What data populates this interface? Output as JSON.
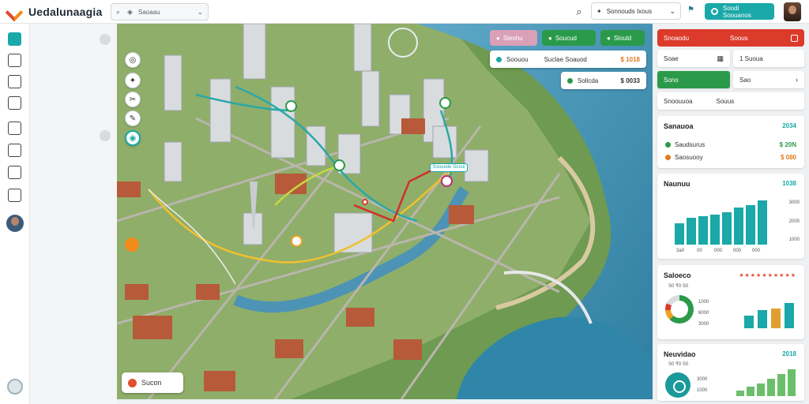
{
  "app": {
    "title": "Uedalunaagia"
  },
  "top_toolbar": {
    "label": "Saoaau",
    "icons": [
      "search-icon",
      "layers-icon"
    ]
  },
  "location_select": {
    "value": "Sonnouds Ixous"
  },
  "primary_action": {
    "label": "Soodi Soouanos"
  },
  "map_overlay": {
    "chips": [
      {
        "label": "Sleohu",
        "color": "#d9a0b8"
      },
      {
        "label": "Soucud",
        "color": "#2a9a4a"
      },
      {
        "label": "Slould",
        "color": "#2a9a4a"
      }
    ],
    "route_card_1": {
      "left": "Soouou",
      "mid": "Suclae Soauod",
      "value": "$ 1018"
    },
    "route_card_2": {
      "left": "Sollcda",
      "value": "$ 0033"
    },
    "route_tag": "Soouede Sooul",
    "legend_button": "Sucon"
  },
  "right_panel": {
    "header": {
      "left": "Snoaodu",
      "right": "Soous"
    },
    "row1": {
      "left": "Soae",
      "right": "1 Suoua"
    },
    "row2": {
      "left": "Sono",
      "right": "Sao"
    },
    "row3": {
      "left": "Snoouuoa",
      "right": "Souus"
    },
    "card1": {
      "title": "Sanauoa",
      "badge": "2034",
      "items": [
        {
          "label": "Saudsurus",
          "value": "$ 20N",
          "color": "#2a9a4a"
        },
        {
          "label": "Saosuooy",
          "value": "$ 080",
          "color": "#e07a20"
        }
      ]
    },
    "card2": {
      "title": "Naunuu",
      "badge": "1038",
      "ticks": [
        "3015",
        "3000",
        "2000",
        "1000"
      ],
      "xlabels": [
        "3a0",
        "00",
        "000",
        "000",
        "000"
      ]
    },
    "card3": {
      "title": "Saloeco",
      "legend": "S0 ₹0 S0",
      "ticks": [
        "1000",
        "6000",
        "3000"
      ],
      "rating": "★★★★★★★★★★"
    },
    "card4": {
      "title": "Neuvidao",
      "badge": "2018",
      "legend": "S0 ₹0 S0",
      "ticks": [
        "3000",
        "1000"
      ]
    }
  },
  "chart_data": [
    {
      "type": "bar",
      "title": "Naunuu",
      "categories": [
        "3a0",
        "00",
        "000",
        "000",
        "000",
        "",
        "",
        ""
      ],
      "values": [
        1200,
        1500,
        1600,
        1700,
        1800,
        2100,
        2200,
        2500
      ],
      "ylim": [
        0,
        3015
      ],
      "color": "#1aa8a8"
    },
    {
      "type": "bar",
      "title": "Saloeco",
      "categories": [
        "",
        "",
        "",
        ""
      ],
      "values": [
        1900,
        2800,
        3000,
        3800
      ],
      "colors": [
        "#1aa8a8",
        "#1aa8a8",
        "#e0a030",
        "#1aa8a8"
      ],
      "ylim": [
        0,
        6000
      ]
    },
    {
      "type": "bar",
      "title": "Neuvidao",
      "categories": [
        "",
        "",
        "",
        "",
        "",
        ""
      ],
      "values": [
        500,
        800,
        1100,
        1500,
        1900,
        2300
      ],
      "ylim": [
        0,
        3000
      ],
      "color": "#6bbf6b"
    }
  ]
}
